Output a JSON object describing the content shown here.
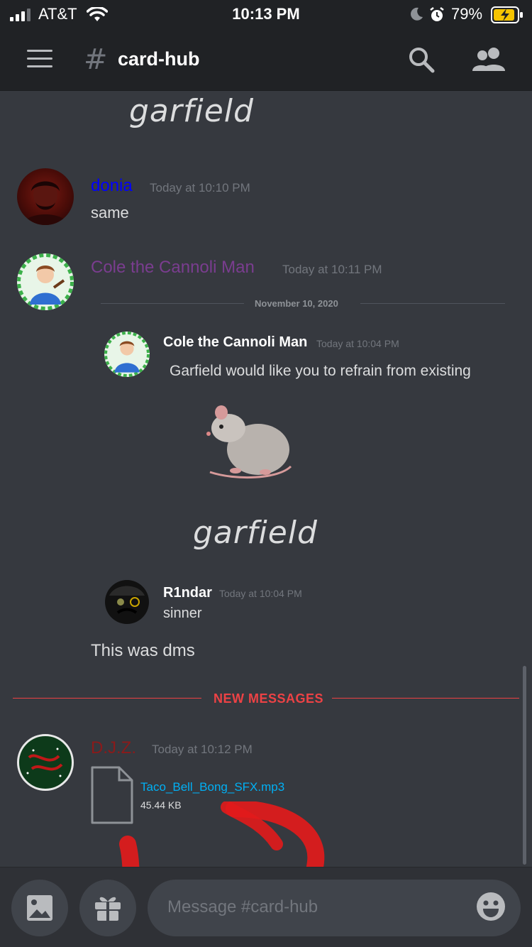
{
  "status_bar": {
    "carrier": "AT&T",
    "time": "10:13 PM",
    "battery": "79%"
  },
  "header": {
    "channel": "card-hub"
  },
  "messages": {
    "top_garfield": "garfield",
    "m1": {
      "author": "donia",
      "author_color": "#0000ff",
      "timestamp": "Today at 10:10 PM",
      "text": "same"
    },
    "m2": {
      "author": "Cole the Cannoli Man",
      "author_color": "#7a3d8f",
      "timestamp": "Today at 10:11 PM",
      "embed_date": "November 10, 2020",
      "quoted": {
        "author": "Cole the Cannoli Man",
        "timestamp": "Today at 10:04 PM",
        "text": "Garfield would like you to refrain from existing",
        "emoji": "🐀",
        "caption": "garfield"
      },
      "quoted2": {
        "author": "R1ndar",
        "timestamp": "Today at 10:04 PM",
        "text": "sinner"
      },
      "text": "This was dms"
    },
    "new_messages_label": "NEW MESSAGES",
    "m3": {
      "author": "D.J.Z.",
      "author_color": "#8b1a1a",
      "timestamp": "Today at 10:12 PM",
      "file_name": "Taco_Bell_Bong_SFX.mp3",
      "file_size": "45.44 KB"
    }
  },
  "composer": {
    "placeholder": "Message #card-hub"
  },
  "icons": [
    "signal-icon",
    "wifi-icon",
    "moon-icon",
    "alarm-icon",
    "battery-icon",
    "menu-icon",
    "hash-icon",
    "search-icon",
    "members-icon",
    "file-icon",
    "image-icon",
    "gift-icon",
    "emoji-icon"
  ]
}
